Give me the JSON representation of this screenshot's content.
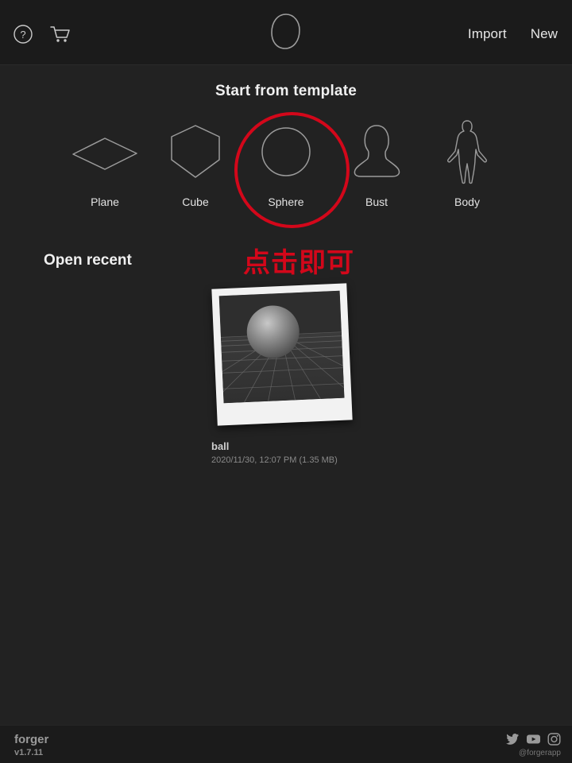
{
  "app": {
    "name": "forger",
    "version": "v1.7.11",
    "social_handle": "@forgerapp",
    "accent_red": "#d3071a",
    "background": "#222222",
    "bar_background": "#1b1b1b"
  },
  "header": {
    "help_icon": "help-circle-icon",
    "cart_icon": "shopping-cart-icon",
    "logo_icon": "forger-blob-logo",
    "import_label": "Import",
    "new_label": "New"
  },
  "templates": {
    "title": "Start from template",
    "items": [
      {
        "label": "Plane",
        "icon": "plane-shape-icon",
        "selected": false
      },
      {
        "label": "Cube",
        "icon": "cube-shape-icon",
        "selected": false
      },
      {
        "label": "Sphere",
        "icon": "sphere-shape-icon",
        "selected": true
      },
      {
        "label": "Bust",
        "icon": "bust-shape-icon",
        "selected": false
      },
      {
        "label": "Body",
        "icon": "body-shape-icon",
        "selected": false
      }
    ]
  },
  "annotation": {
    "text": "点击即可",
    "target": "Sphere",
    "color": "#d3071a"
  },
  "recent": {
    "title": "Open recent",
    "files": [
      {
        "name": "ball",
        "meta": "2020/11/30, 12:07 PM (1.35 MB)",
        "date": "2020/11/30",
        "time": "12:07 PM",
        "size": "1.35 MB",
        "thumbnail": "sphere-on-grid-render"
      }
    ]
  },
  "footer": {
    "social": [
      {
        "name": "twitter-icon"
      },
      {
        "name": "youtube-icon"
      },
      {
        "name": "instagram-icon"
      }
    ]
  }
}
